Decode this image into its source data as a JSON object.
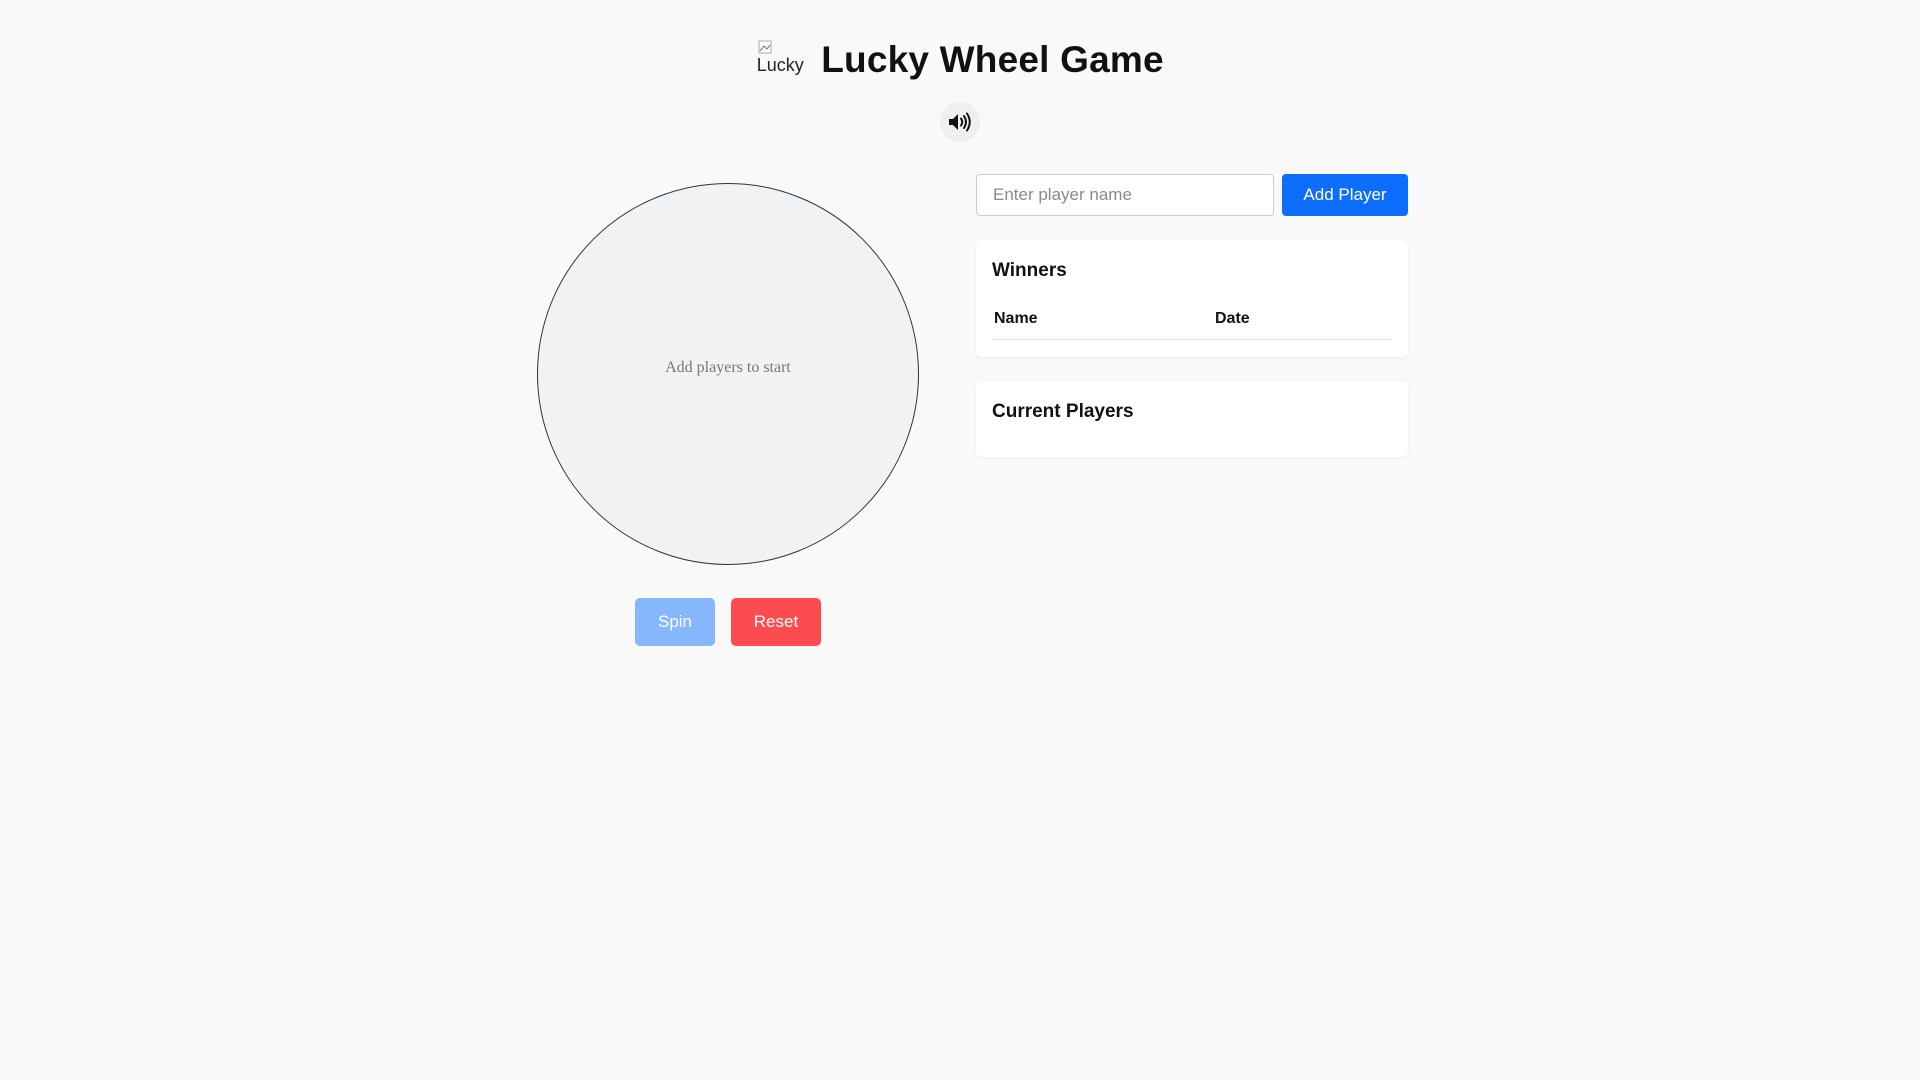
{
  "header": {
    "logo_alt": "Lucky ..",
    "title": "Lucky Wheel Game"
  },
  "sound": {
    "icon": "speaker-volume-icon"
  },
  "wheel": {
    "empty_text": "Add players to start"
  },
  "controls": {
    "spin_label": "Spin",
    "reset_label": "Reset"
  },
  "add_player": {
    "placeholder": "Enter player name",
    "button_label": "Add Player"
  },
  "winners": {
    "title": "Winners",
    "columns": [
      "Name",
      "Date"
    ],
    "rows": []
  },
  "current_players": {
    "title": "Current Players",
    "players": []
  },
  "colors": {
    "primary": "#0d6efd",
    "primary_disabled": "#86b6fb",
    "danger": "#fc4c4f",
    "background": "#f9f9f9"
  }
}
